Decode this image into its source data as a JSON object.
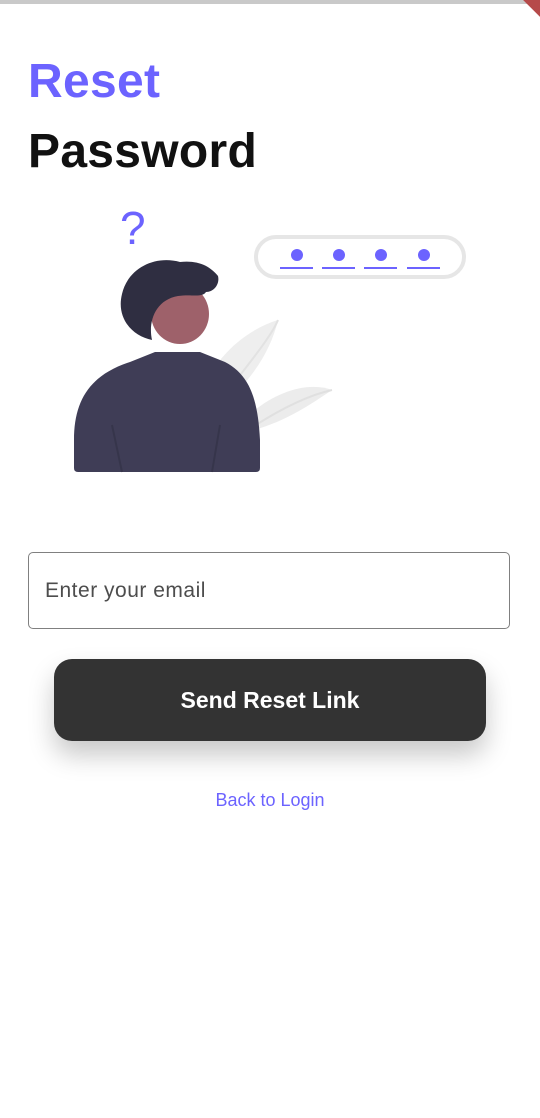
{
  "header": {
    "title_line1": "Reset",
    "title_line2": "Password"
  },
  "illustration": {
    "name": "forgot-password-illustration",
    "question_mark": "?"
  },
  "email": {
    "placeholder": "Enter your email",
    "value": ""
  },
  "actions": {
    "send_label": "Send Reset Link",
    "back_label": "Back to Login"
  },
  "colors": {
    "accent": "#6c63ff",
    "button": "#333333",
    "title": "#111111"
  }
}
